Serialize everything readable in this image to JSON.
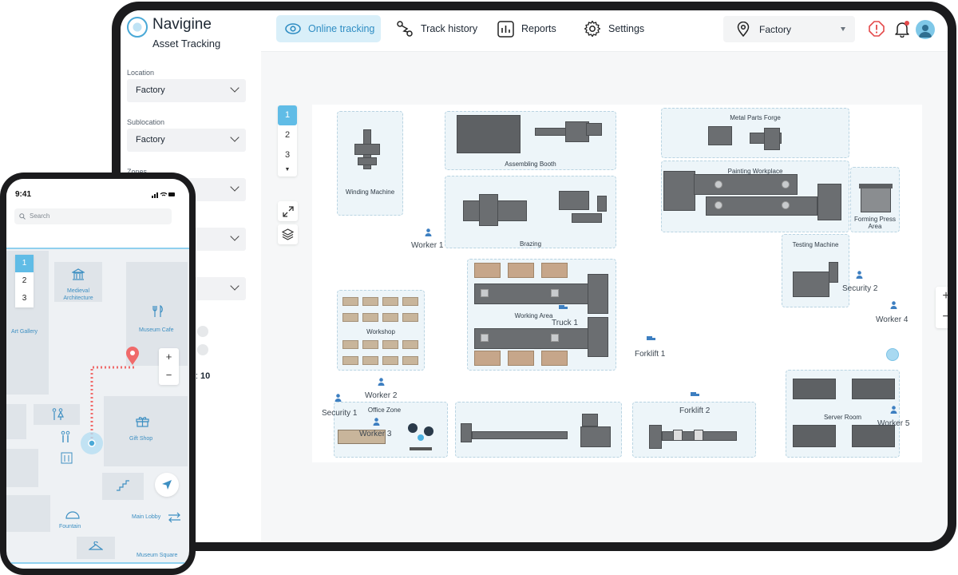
{
  "app": {
    "name": "Navigine",
    "subtitle": "Asset Tracking"
  },
  "nav": {
    "online_tracking": "Online tracking",
    "track_history": "Track history",
    "reports": "Reports",
    "settings": "Settings"
  },
  "location_select": {
    "value": "Factory"
  },
  "sidebar": {
    "location_label": "Location",
    "location_value": "Factory",
    "sublocation_label": "Sublocation",
    "sublocation_value": "Factory",
    "zones_label": "Zones",
    "floor_label_partial": "oor:",
    "floor_value": "10"
  },
  "floors": [
    "1",
    "2",
    "3"
  ],
  "zones": {
    "winding": "Winding Machine",
    "assembling": "Assembling Booth",
    "metal_forge": "Metal Parts Forge",
    "painting": "Painting Workplace",
    "forming": "Forming Press Area",
    "brazing": "Brazing",
    "testing": "Testing Machine",
    "working_area": "Working Area",
    "workshop": "Workshop",
    "office_zone": "Office Zone",
    "server_room": "Server Room"
  },
  "assets": {
    "worker1": "Worker 1",
    "worker2": "Worker 2",
    "worker3": "Worker 3",
    "worker4": "Worker 4",
    "worker5": "Worker 5",
    "security1": "Security 1",
    "security2": "Security 2",
    "truck1": "Truck 1",
    "forklift1": "Forklift 1",
    "forklift2": "Forklift 2"
  },
  "zoom": {
    "in": "+",
    "out": "−"
  },
  "phone": {
    "time": "9:41",
    "search_placeholder": "Search",
    "floors": [
      "1",
      "2",
      "3"
    ],
    "places": {
      "medieval": "Medieval Architecture",
      "art_gallery": "Art Gallery",
      "museum_cafe": "Museum Cafe",
      "gift_shop": "Gift Shop",
      "main_lobby": "Main Lobby",
      "fountain": "Fountain",
      "museum_square": "Museum Square"
    }
  },
  "colors": {
    "accent": "#60bce6",
    "route": "#f06a6a",
    "machine": "#6b6e71"
  }
}
